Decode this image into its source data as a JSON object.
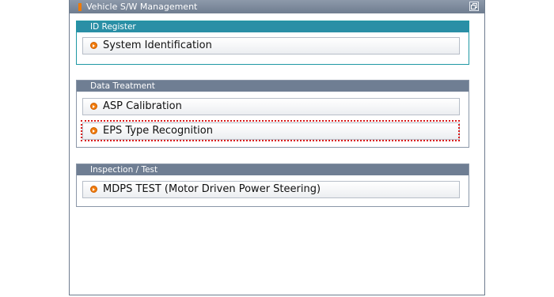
{
  "window": {
    "title": "Vehicle S/W Management"
  },
  "sections": {
    "id_register": {
      "title": "ID Register",
      "items": [
        {
          "label": "System Identification"
        }
      ]
    },
    "data_treatment": {
      "title": "Data Treatment",
      "items": [
        {
          "label": "ASP Calibration"
        },
        {
          "label": "EPS Type Recognition"
        }
      ]
    },
    "inspection": {
      "title": "Inspection / Test",
      "items": [
        {
          "label": "MDPS TEST (Motor Driven Power Steering)"
        }
      ]
    }
  },
  "highlighted_item": "EPS Type Recognition",
  "colors": {
    "titlebar": "#6f7d90",
    "id_section_header": "#2a8fa6",
    "section_header": "#6f7e93",
    "bullet": "#f27c0b",
    "highlight": "#d81a1a"
  },
  "icons": {
    "title_mark": "orange-bar-icon",
    "title_button": "window-restore-icon",
    "item_bullet": "orange-arrow-bullet-icon"
  }
}
